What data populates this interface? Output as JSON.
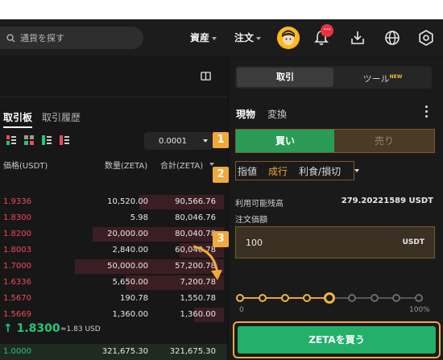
{
  "header": {
    "search_placeholder": "通貨を探す",
    "nav_assets": "資産",
    "nav_orders": "注文",
    "notification_count": "···"
  },
  "orderbook": {
    "tab_active": "取引板",
    "tab_history": "取引履歴",
    "precision": "0.0001",
    "col_price": "価格(USDT)",
    "col_qty": "数量(ZETA)",
    "col_total": "合計(ZETA)",
    "asks": [
      {
        "price": "1.9336",
        "qty": "10,520.00",
        "total": "90,566.76",
        "depth": 0.57
      },
      {
        "price": "1.8300",
        "qty": "5.98",
        "total": "80,046.76",
        "depth": 0.0
      },
      {
        "price": "1.8200",
        "qty": "20,000.00",
        "total": "80,040.78",
        "depth": 0.88
      },
      {
        "price": "1.8003",
        "qty": "2,840.00",
        "total": "60,040.78",
        "depth": 0.3
      },
      {
        "price": "1.7000",
        "qty": "50,000.00",
        "total": "57,200.78",
        "depth": 1.0
      },
      {
        "price": "1.6336",
        "qty": "5,650.00",
        "total": "7,200.78",
        "depth": 0.66
      },
      {
        "price": "1.5670",
        "qty": "190.78",
        "total": "1,550.78",
        "depth": 0.0
      },
      {
        "price": "1.5669",
        "qty": "1,360.00",
        "total": "1,360.00",
        "depth": 0.2
      }
    ],
    "last_price": "↑ 1.8300",
    "last_price_approx": "≈1.83 USD",
    "bid": {
      "price": "1.0000",
      "qty": "321,675.30",
      "total": "321,675.30"
    }
  },
  "trade": {
    "tab_trade": "取引",
    "tab_tools": "ツール",
    "tools_badge": "NEW",
    "mode_spot": "現物",
    "mode_convert": "変換",
    "buy_label": "買い",
    "sell_label": "売り",
    "order_type_limit": "指値",
    "order_type_market": "成行",
    "order_type_tpsl": "利食/損切",
    "available_label": "利用可能残高",
    "available_value": "279.20221589 USDT",
    "price_label": "注文価額",
    "price_value": "100",
    "price_unit": "USDT",
    "slider_value": 0.5,
    "slider_min": "0",
    "slider_max": "100%",
    "submit_label": "ZETAを買う"
  },
  "callouts": [
    "1",
    "2",
    "3"
  ],
  "colors": {
    "accent": "#f0a93a",
    "buy": "#22b06a",
    "ask": "#f04a5a",
    "up": "#22c77a"
  }
}
